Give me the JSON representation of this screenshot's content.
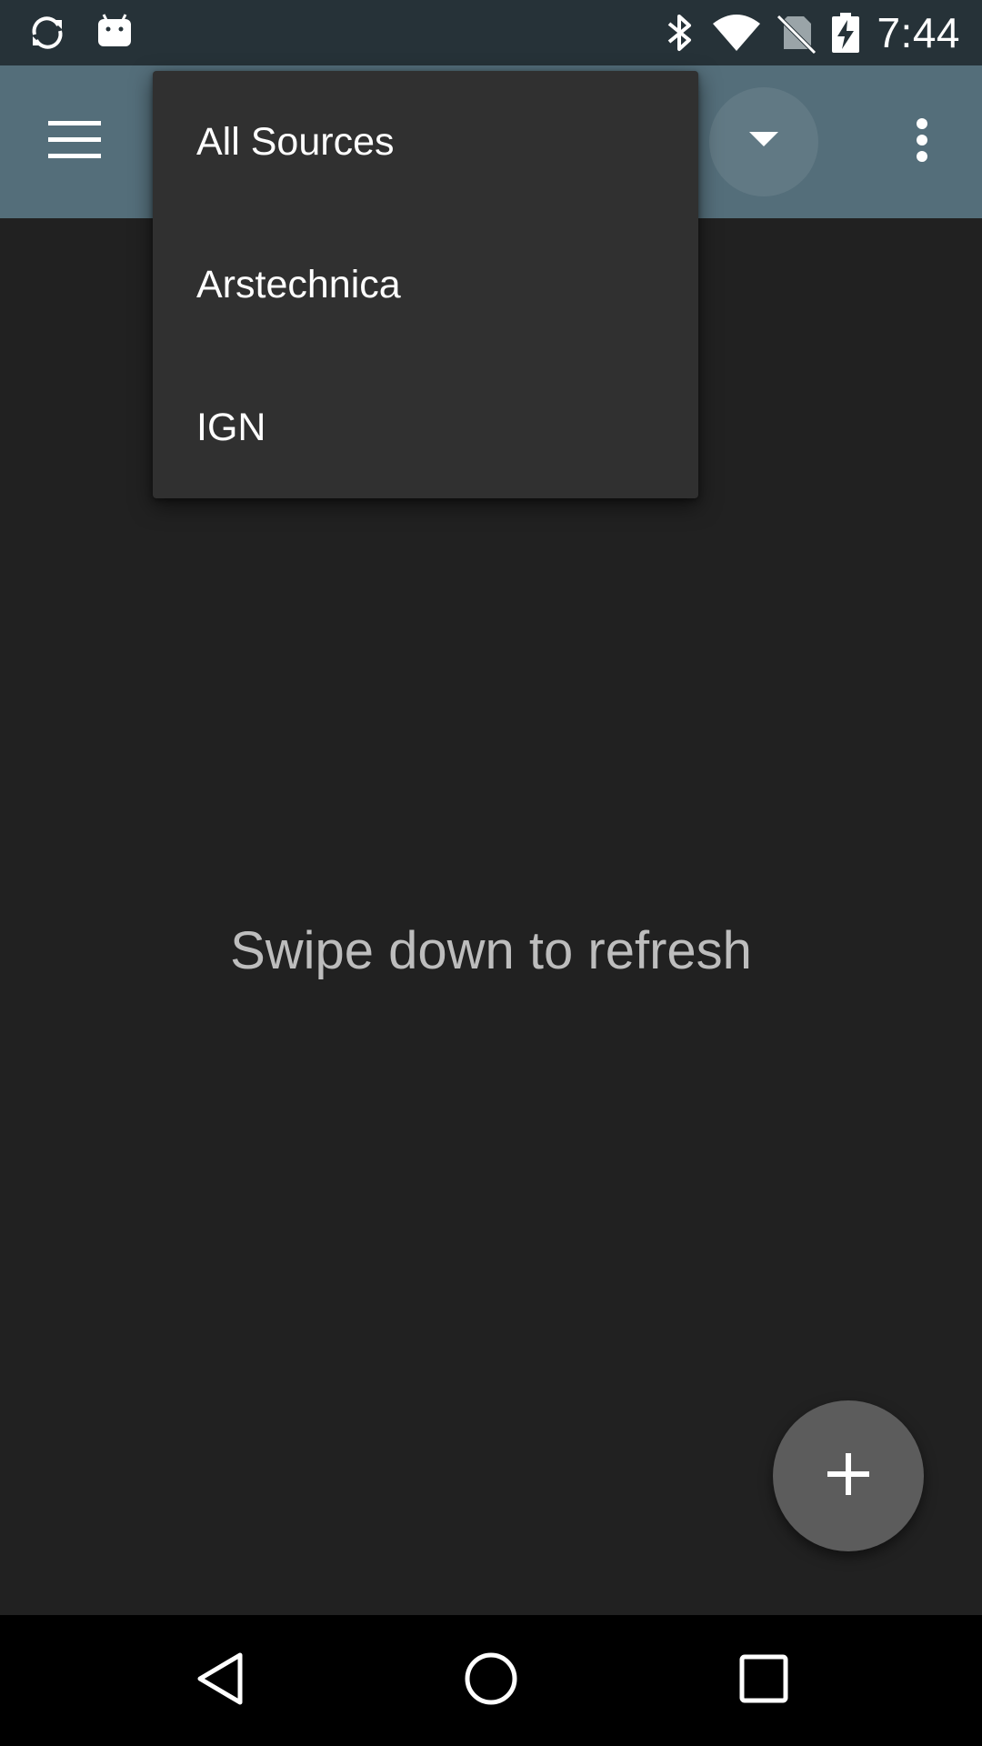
{
  "status_bar": {
    "time": "7:44",
    "icons_left": [
      "sync-icon",
      "android-icon"
    ],
    "icons_right": [
      "bluetooth-icon",
      "wifi-icon",
      "no-sim-icon",
      "battery-charging-icon"
    ]
  },
  "app_bar": {
    "menu_icon": "hamburger-menu-icon",
    "spinner_icon": "dropdown-arrow-icon",
    "overflow_icon": "more-vert-icon",
    "background_color": "#546e7a"
  },
  "dropdown": {
    "items": [
      {
        "label": "All Sources"
      },
      {
        "label": "Arstechnica"
      },
      {
        "label": "IGN"
      }
    ]
  },
  "main": {
    "empty_message": "Swipe down to refresh"
  },
  "fab": {
    "icon": "plus-icon"
  },
  "nav_bar": {
    "buttons": [
      "back-icon",
      "home-icon",
      "recents-icon"
    ]
  }
}
